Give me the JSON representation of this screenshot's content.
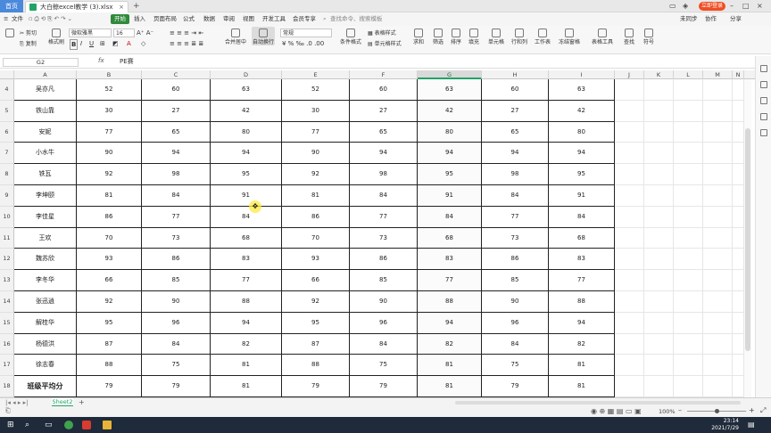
{
  "titlebar": {
    "home_tab": "首页",
    "doc_title": "大白鲸excel教学 (3).xlsx",
    "login": "立即登录"
  },
  "menubar": {
    "items": [
      "文件",
      "开始",
      "插入",
      "页面布局",
      "公式",
      "数据",
      "审阅",
      "视图",
      "开发工具",
      "会员专享"
    ],
    "search_placeholder": "查找命令、搜索模板",
    "right": [
      "未同步",
      "协作",
      "分享"
    ]
  },
  "ribbon": {
    "cut": "剪切",
    "copy": "复制",
    "format_painter": "格式刷",
    "font_name": "微软雅黑",
    "font_size": "16",
    "merge": "合并居中",
    "wrap": "自动换行",
    "number_format": "常规",
    "cond_format": "条件格式",
    "table_style": "表格样式",
    "cell_style": "单元格样式",
    "sum": "求和",
    "filter": "筛选",
    "sort": "排序",
    "fill": "填充",
    "cells": "单元格",
    "rows_cols": "行和列",
    "worksheet": "工作表",
    "freeze": "冻结窗格",
    "table_tools": "表格工具",
    "find": "查找",
    "symbol": "符号"
  },
  "formula_bar": {
    "name_box": "G2",
    "fx": "fx",
    "content": "PE赛"
  },
  "columns": [
    "A",
    "B",
    "C",
    "D",
    "E",
    "F",
    "G",
    "H",
    "I",
    "J",
    "K",
    "L",
    "M",
    "N"
  ],
  "selected_column": "G",
  "rows": [
    {
      "num": "4",
      "name": "吴亦凡",
      "values": [
        "52",
        "60",
        "63",
        "52",
        "60",
        "63",
        "60",
        "63"
      ]
    },
    {
      "num": "5",
      "name": "铁山靠",
      "values": [
        "30",
        "27",
        "42",
        "30",
        "27",
        "42",
        "27",
        "42"
      ]
    },
    {
      "num": "6",
      "name": "安妮",
      "values": [
        "77",
        "65",
        "80",
        "77",
        "65",
        "80",
        "65",
        "80"
      ]
    },
    {
      "num": "7",
      "name": "小水牛",
      "values": [
        "90",
        "94",
        "94",
        "90",
        "94",
        "94",
        "94",
        "94"
      ]
    },
    {
      "num": "8",
      "name": "铁瓦",
      "values": [
        "92",
        "98",
        "95",
        "92",
        "98",
        "95",
        "98",
        "95"
      ]
    },
    {
      "num": "9",
      "name": "李坤颐",
      "values": [
        "81",
        "84",
        "91",
        "81",
        "84",
        "91",
        "84",
        "91"
      ]
    },
    {
      "num": "10",
      "name": "李佳星",
      "values": [
        "86",
        "77",
        "84",
        "86",
        "77",
        "84",
        "77",
        "84"
      ]
    },
    {
      "num": "11",
      "name": "王欢",
      "values": [
        "70",
        "73",
        "68",
        "70",
        "73",
        "68",
        "73",
        "68"
      ]
    },
    {
      "num": "12",
      "name": "魏苏欣",
      "values": [
        "93",
        "86",
        "83",
        "93",
        "86",
        "83",
        "86",
        "83"
      ]
    },
    {
      "num": "13",
      "name": "李冬华",
      "values": [
        "66",
        "85",
        "77",
        "66",
        "85",
        "77",
        "85",
        "77"
      ]
    },
    {
      "num": "14",
      "name": "张迅逍",
      "values": [
        "92",
        "90",
        "88",
        "92",
        "90",
        "88",
        "90",
        "88"
      ]
    },
    {
      "num": "15",
      "name": "解桂华",
      "values": [
        "95",
        "96",
        "94",
        "95",
        "96",
        "94",
        "96",
        "94"
      ]
    },
    {
      "num": "16",
      "name": "杨德洪",
      "values": [
        "87",
        "84",
        "82",
        "87",
        "84",
        "82",
        "84",
        "82"
      ]
    },
    {
      "num": "17",
      "name": "徐志春",
      "values": [
        "88",
        "75",
        "81",
        "88",
        "75",
        "81",
        "75",
        "81"
      ]
    },
    {
      "num": "18",
      "name": "班级平均分",
      "values": [
        "79",
        "79",
        "81",
        "79",
        "79",
        "81",
        "79",
        "81"
      ],
      "bold": true
    }
  ],
  "sheets": [
    "Sheet2"
  ],
  "status": {
    "zoom": "100%"
  },
  "taskbar": {
    "time": "23:14",
    "date": "2021/7/29"
  },
  "colors": {
    "accent_green": "#21a366",
    "home_tab_blue": "#4a89dc",
    "login_orange": "#f04e23",
    "taskbar": "#1f2a3a"
  }
}
